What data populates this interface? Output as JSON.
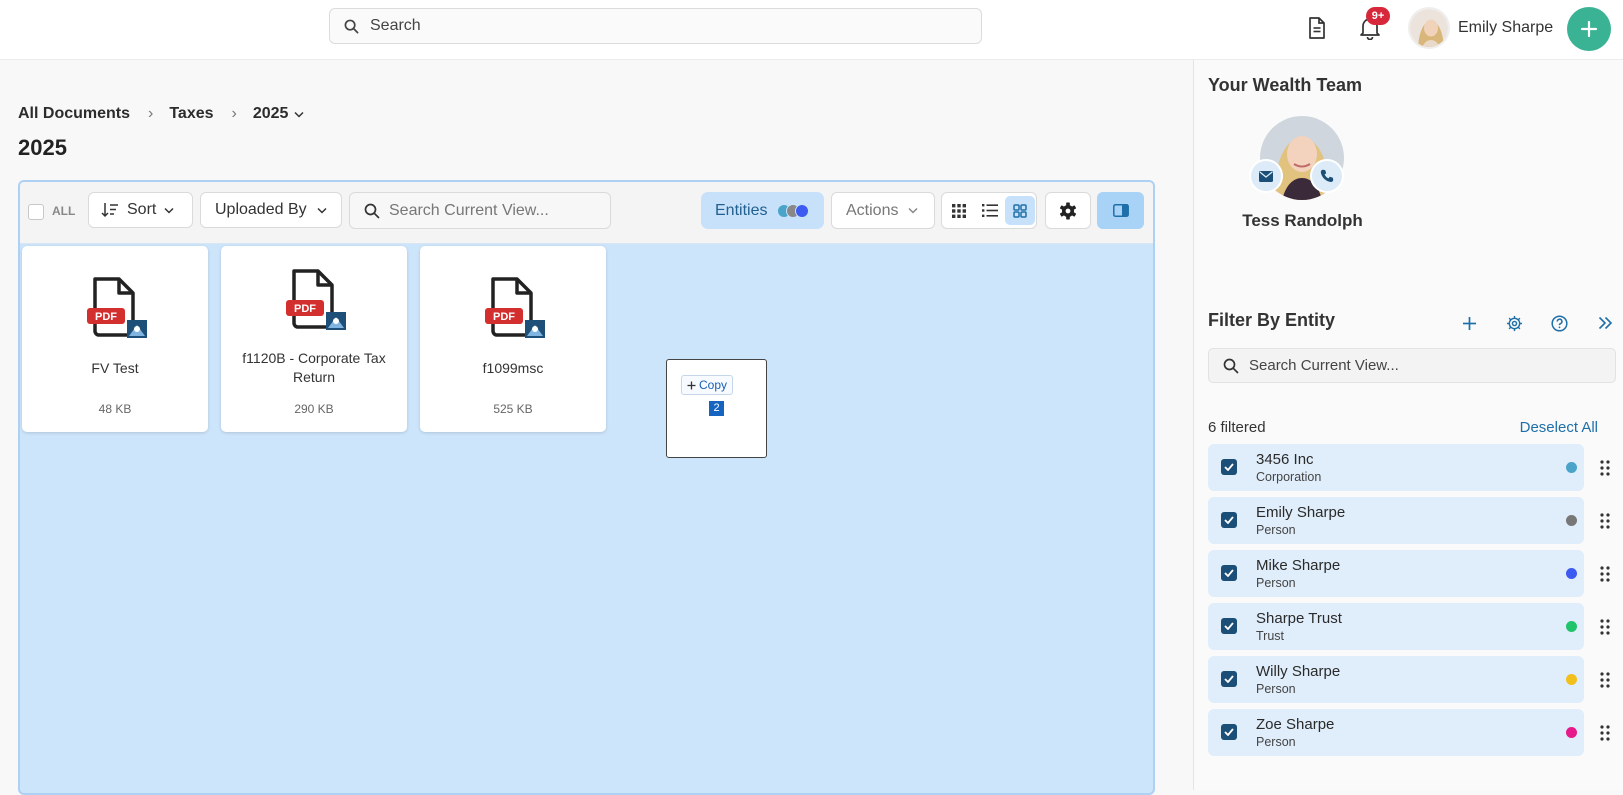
{
  "topbar": {
    "search_label": "Search",
    "notification_badge": "9+",
    "user_name": "Emily Sharpe"
  },
  "breadcrumb": [
    "All Documents",
    "Taxes",
    "2025"
  ],
  "page_title": "2025",
  "toolbar": {
    "all_label": "ALL",
    "sort_label": "Sort",
    "uploaded_by_label": "Uploaded By",
    "search_placeholder": "Search Current View...",
    "entities_label": "Entities",
    "actions_label": "Actions"
  },
  "files": [
    {
      "name": "FV Test",
      "size": "48 KB",
      "badge": "PDF"
    },
    {
      "name": "f1120B - Corporate Tax Return",
      "size": "290 KB",
      "badge": "PDF"
    },
    {
      "name": "f1099msc",
      "size": "525 KB",
      "badge": "PDF"
    }
  ],
  "drag": {
    "copy_label": "Copy",
    "count": "2"
  },
  "sidebar": {
    "team_title": "Your Wealth Team",
    "team_member": "Tess Randolph",
    "filter_title": "Filter By Entity",
    "search_placeholder": "Search Current View...",
    "filtered_count": "6 filtered",
    "deselect_all": "Deselect All",
    "entities": [
      {
        "name": "3456 Inc",
        "type": "Corporation",
        "color": "#4aa3c9"
      },
      {
        "name": "Emily Sharpe",
        "type": "Person",
        "color": "#777777"
      },
      {
        "name": "Mike Sharpe",
        "type": "Person",
        "color": "#3d5bf0"
      },
      {
        "name": "Sharpe Trust",
        "type": "Trust",
        "color": "#22c46b"
      },
      {
        "name": "Willy Sharpe",
        "type": "Person",
        "color": "#f2c01c"
      },
      {
        "name": "Zoe Sharpe",
        "type": "Person",
        "color": "#e61a8a"
      }
    ]
  },
  "colors": {
    "accent": "#39b394",
    "panel": "#cde5fb",
    "pdf_badge": "#d32f2f"
  }
}
